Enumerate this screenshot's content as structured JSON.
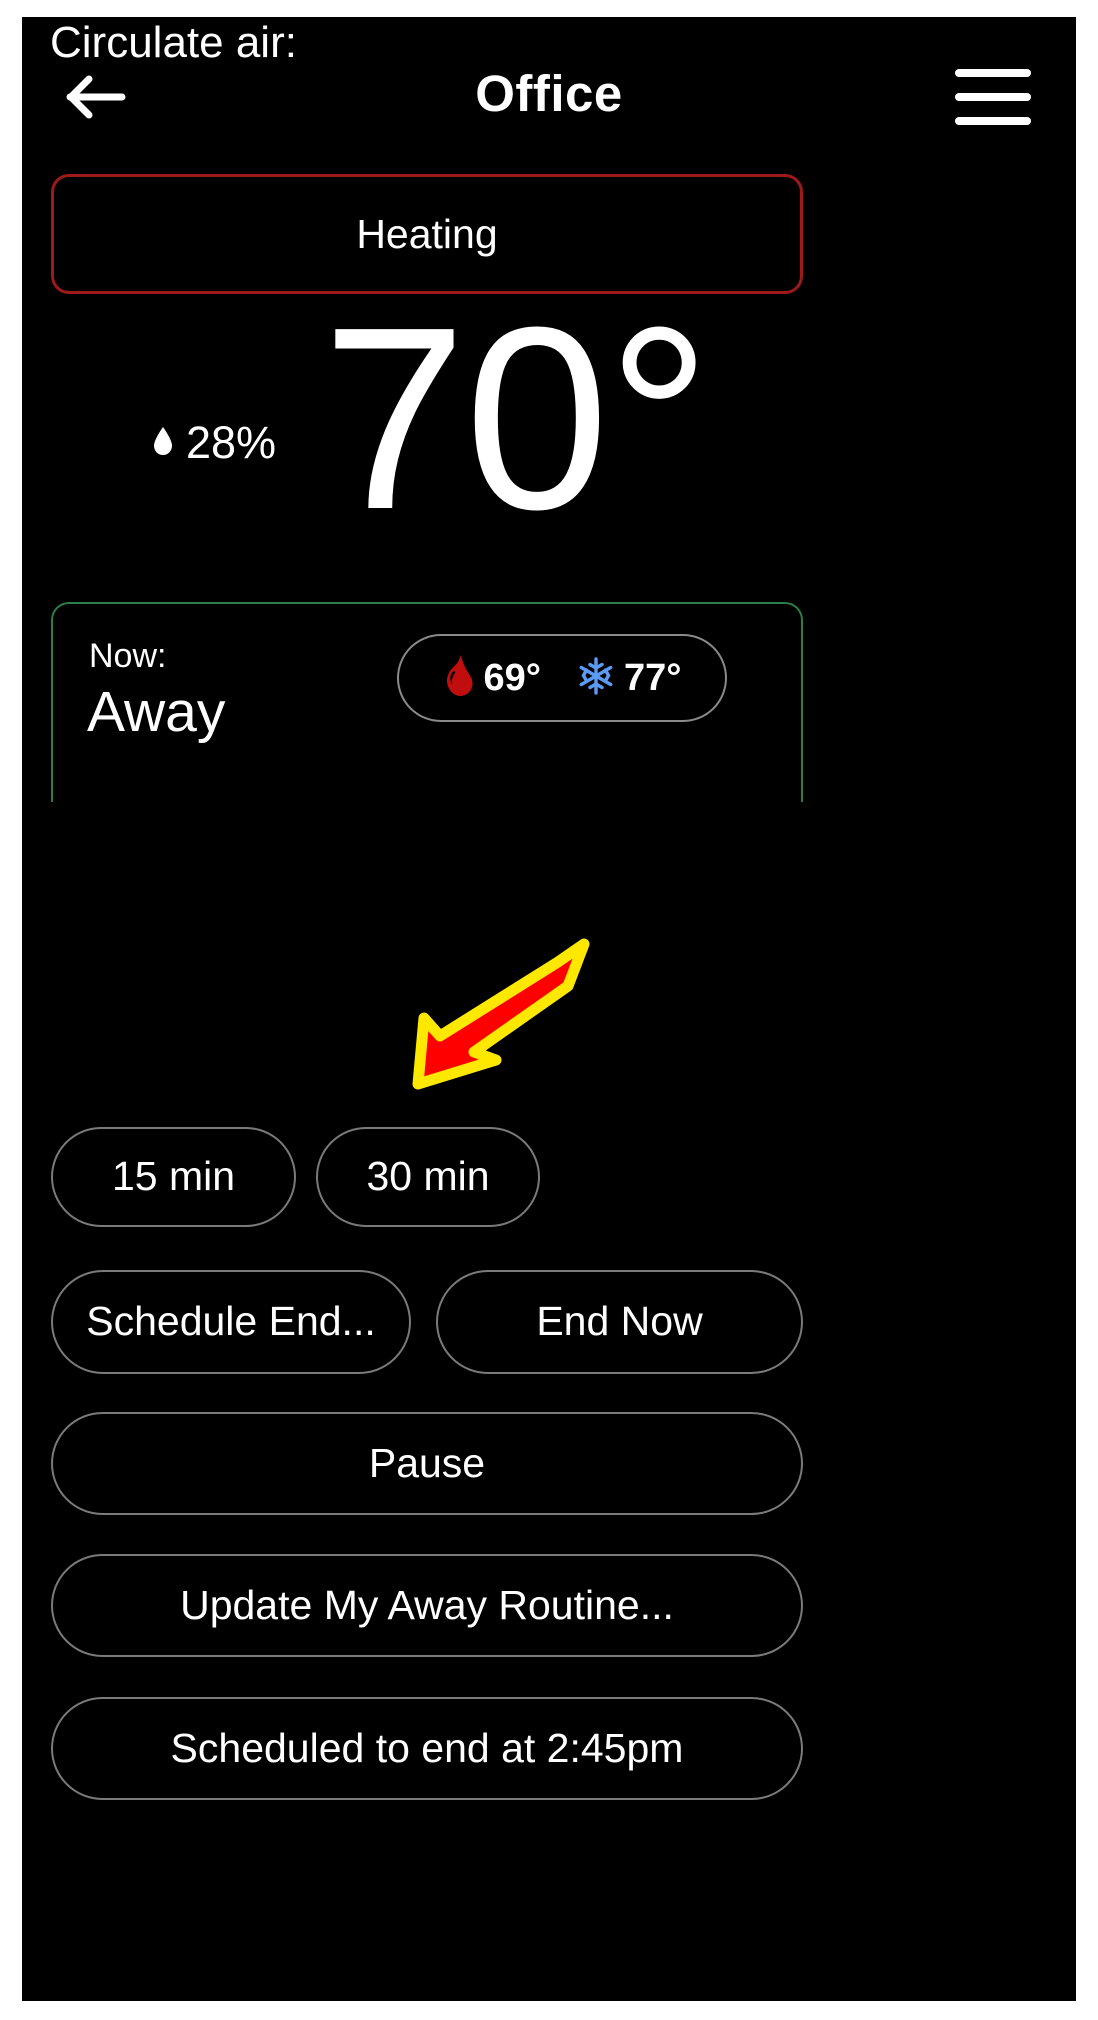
{
  "header": {
    "back_icon": "arrow-left-icon",
    "title": "Office",
    "menu_icon": "hamburger-menu-icon"
  },
  "mode": {
    "label": "Heating",
    "border_color": "#9e1a1a"
  },
  "current": {
    "temperature": "70°",
    "humidity": "28%",
    "humidity_icon": "water-drop-icon"
  },
  "schedule_card": {
    "now_label": "Now:",
    "now_value": "Away",
    "border_color": "#2d7d46",
    "setpoints": [
      {
        "icon": "flame-icon",
        "icon_color": "#c00d0d",
        "value": "69°"
      },
      {
        "icon": "snowflake-icon",
        "icon_color": "#5b9bf5",
        "value": "77°"
      }
    ]
  },
  "circulate": {
    "section_label": "Circulate air:",
    "options": [
      {
        "label": "15 min"
      },
      {
        "label": "30 min"
      }
    ]
  },
  "actions": {
    "schedule_end": "Schedule End...",
    "end_now": "End Now",
    "pause": "Pause",
    "update_routine": "Update My Away Routine...",
    "scheduled_status": "Scheduled to end at 2:45pm"
  },
  "annotation": {
    "type": "arrow",
    "points_to": "Schedule End...",
    "fill_color": "#FF0000",
    "outline_color": "#FFE800"
  }
}
